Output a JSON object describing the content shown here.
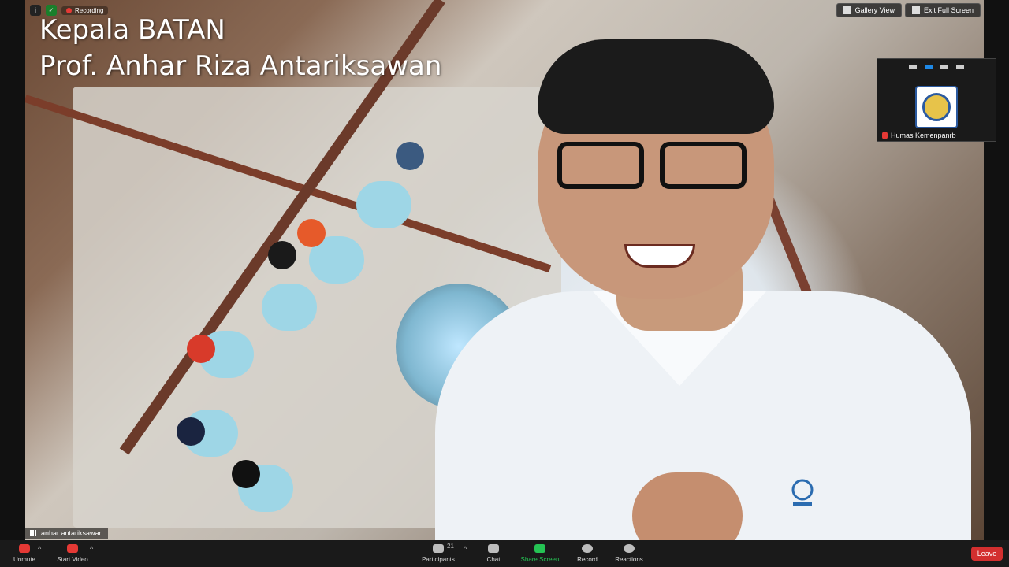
{
  "overlay": {
    "recording_label": "Recording",
    "speaker_title_line1": "Kepala BATAN",
    "speaker_title_line2": "Prof. Anhar Riza Antariksawan",
    "gallery_view_label": "Gallery View",
    "exit_full_screen_label": "Exit Full Screen",
    "participant_name_tag": "anhar antariksawan",
    "thumbnail_participant_name": "Humas Kemenpanrb"
  },
  "toolbar": {
    "unmute_label": "Unmute",
    "start_video_label": "Start Video",
    "participants_label": "Participants",
    "participants_count": "21",
    "chat_label": "Chat",
    "share_screen_label": "Share Screen",
    "record_label": "Record",
    "reactions_label": "Reactions",
    "leave_label": "Leave"
  },
  "colors": {
    "accent_green": "#25c454",
    "leave_red": "#d32f2f",
    "recording_red": "#e53935",
    "active_blue": "#1e88e5"
  },
  "icons": {
    "info": "info-icon",
    "security": "shield-icon",
    "recording": "recording-dot-icon",
    "gallery": "grid-icon",
    "exit_fullscreen": "collapse-icon",
    "mic": "mic-muted-icon",
    "video": "video-off-icon",
    "participants": "people-icon",
    "chat": "chat-icon",
    "share": "share-screen-icon",
    "record": "record-icon",
    "reactions": "reactions-icon"
  }
}
